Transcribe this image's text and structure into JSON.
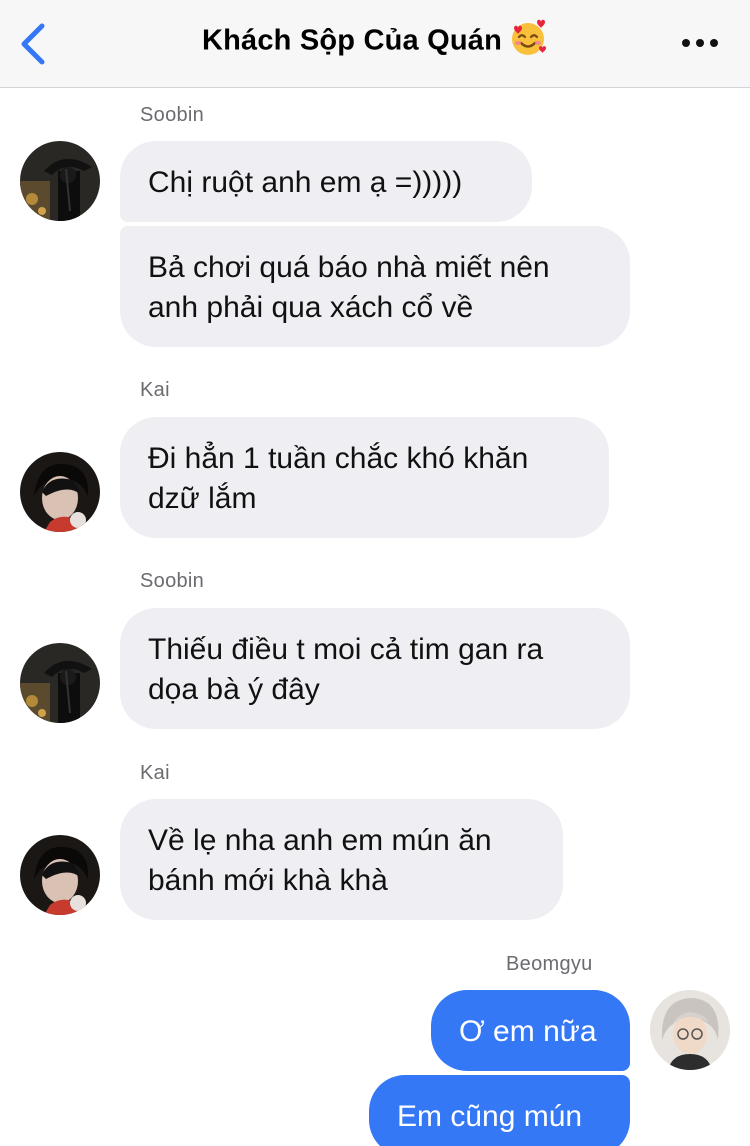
{
  "header": {
    "title": "Khách Sộp Của Quán",
    "title_emoji": "smiling-face-with-hearts-icon",
    "back": "chevron-left-icon",
    "more": "more-dots-icon",
    "accent_color": "#3478f6"
  },
  "messages": [
    {
      "sender": "Soobin",
      "avatar": "soobin-avatar",
      "texts": [
        "Chị ruột anh em ạ =)))))",
        "Bả chơi quá báo nhà miết nên\nanh phải qua xách cổ về"
      ]
    },
    {
      "sender": "Kai",
      "avatar": "kai-avatar",
      "texts": [
        "Đi hẳn 1 tuần chắc khó khăn\ndzữ lắm"
      ]
    },
    {
      "sender": "Soobin",
      "avatar": "soobin-avatar",
      "texts": [
        "Thiếu điều t moi cả tim gan ra\ndọa bà ý đây"
      ]
    },
    {
      "sender": "Kai",
      "avatar": "kai-avatar",
      "texts": [
        "Về lẹ nha anh em mún ăn\nbánh mới khà khà"
      ]
    },
    {
      "sender": "Beomgyu",
      "avatar": "beomgyu-avatar",
      "texts": [
        "Ơ em nữa",
        "Em cũng mún"
      ]
    }
  ],
  "colors": {
    "incoming_bubble": "#efeff3",
    "outgoing_bubble": "#3478f6",
    "sender_label": "#6b6b70"
  }
}
